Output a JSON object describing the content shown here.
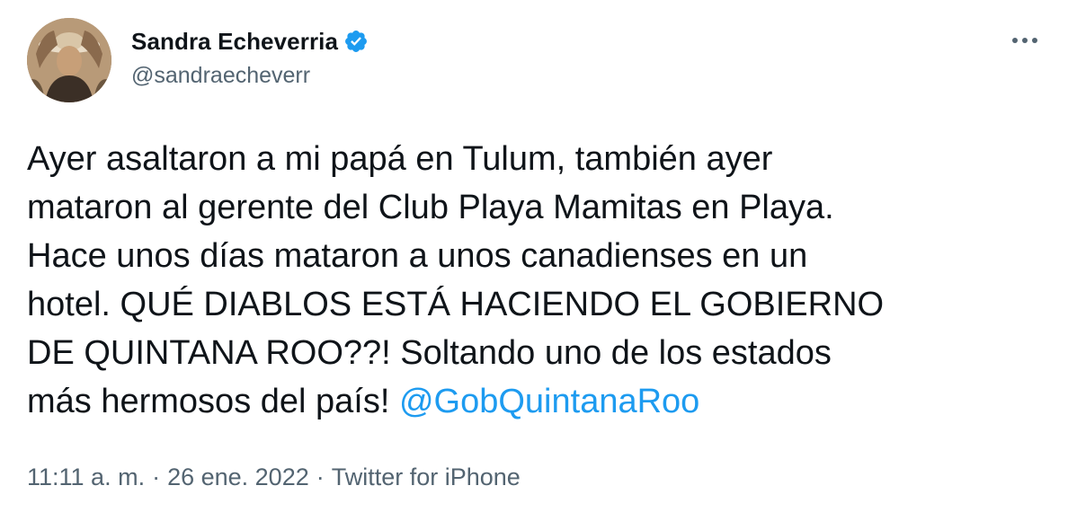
{
  "author": {
    "display_name": "Sandra Echeverria",
    "handle": "@sandraecheverr"
  },
  "tweet": {
    "text_before_mention": "Ayer asaltaron a mi papá en Tulum, también ayer\nmataron al gerente del Club Playa Mamitas en Playa.\nHace unos días mataron a unos canadienses en un\nhotel. QUÉ DIABLOS ESTÁ HACIENDO EL GOBIERNO\nDE QUINTANA ROO??! Soltando uno de los estados\nmás hermosos del país! ",
    "mention": "@GobQuintanaRoo"
  },
  "meta": {
    "time": "11:11 a. m.",
    "date": "26 ene. 2022",
    "source": "Twitter for iPhone",
    "separator": "·"
  },
  "colors": {
    "text": "#0f1419",
    "secondary": "#536471",
    "accent": "#1d9bf0"
  },
  "icons": {
    "verified": "verified-badge-icon",
    "more": "more-options-icon"
  }
}
